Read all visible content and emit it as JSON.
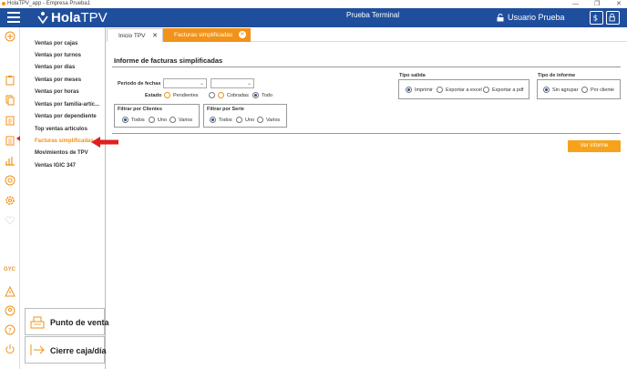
{
  "window": {
    "title": "HolaTPV_app - Empresa Prueba1"
  },
  "header": {
    "logo_bold": "Hola",
    "logo_light": "TPV",
    "center_text": "Prueba Terminal",
    "user_label": "Usuario Prueba"
  },
  "rail": {
    "gyc_label": "GYC"
  },
  "sidebar": {
    "items": [
      {
        "label": "Ventas por cajas"
      },
      {
        "label": "Ventas por turnos"
      },
      {
        "label": "Ventas por días"
      },
      {
        "label": "Ventas por meses"
      },
      {
        "label": "Ventas por horas"
      },
      {
        "label": "Ventas por familia-artíc..."
      },
      {
        "label": "Ventas por dependiente"
      },
      {
        "label": "Top ventas artículos"
      },
      {
        "label": "Facturas simplificadas"
      },
      {
        "label": "Movimientos de TPV"
      },
      {
        "label": "Ventas IGIC 347"
      }
    ],
    "active_index": 8,
    "punto_venta": "Punto de venta",
    "cierre_caja": "Cierre caja/día"
  },
  "tabs": [
    {
      "label": "Inicio TPV"
    },
    {
      "label": "Facturas simplificadas"
    }
  ],
  "report": {
    "title": "Informe de facturas simplificadas",
    "periodo_label": "Periodo de fechas",
    "estado_label": "Estado",
    "estado_options": [
      "Pendientes",
      "Cobradas",
      "Todo"
    ],
    "estado_selected": "Todo",
    "clientes_title": "Filtrar por Clientes",
    "clientes_options": [
      "Todos",
      "Uno",
      "Varios"
    ],
    "serie_title": "Filtrar por Serie",
    "serie_options": [
      "Todos",
      "Uno",
      "Varios"
    ],
    "salida_title": "Tipo salida",
    "salida_options": [
      "Imprimir",
      "Exportar a excel",
      "Exportar a pdf"
    ],
    "informe_title": "Tipo de informe",
    "informe_options": [
      "Sin agrupar",
      "Por cliente"
    ],
    "ver_button": "Ver informe"
  },
  "colors": {
    "header": "#1f4f9c",
    "accent": "#f29219",
    "arrow": "#e02020"
  }
}
